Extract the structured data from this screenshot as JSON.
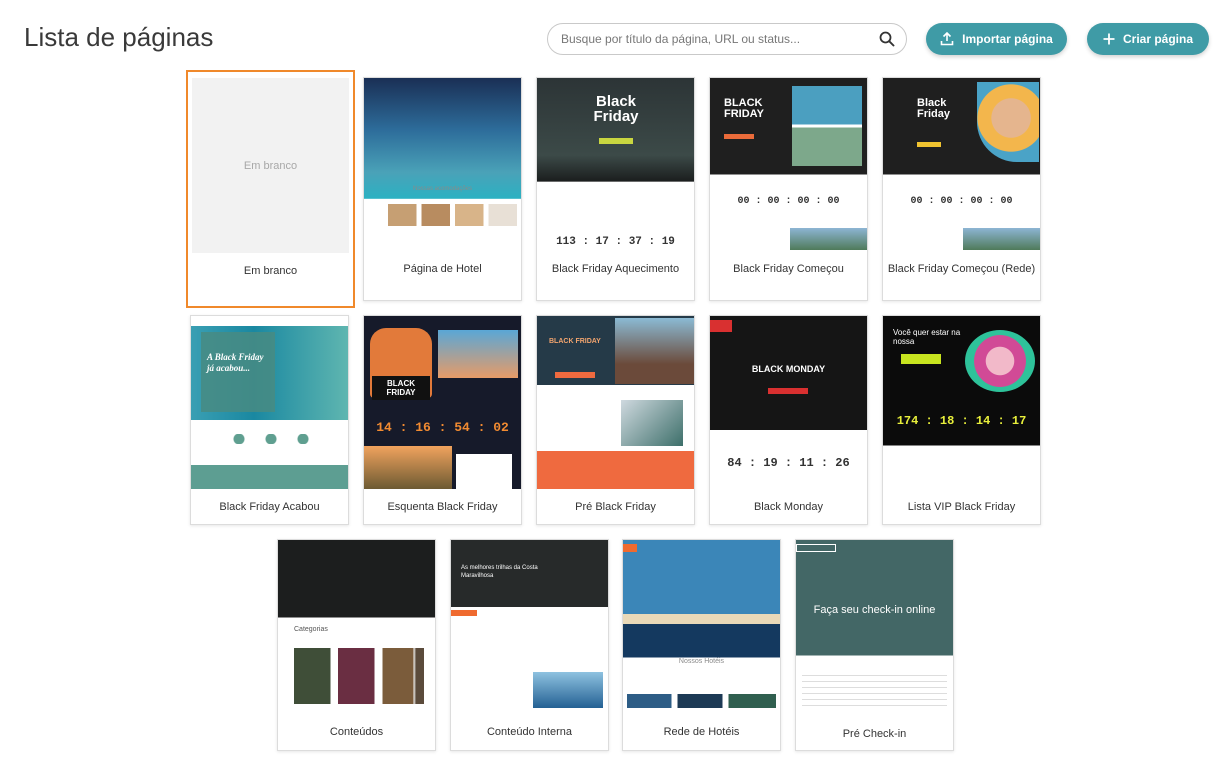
{
  "header": {
    "title": "Lista de páginas",
    "search_placeholder": "Busque por título da página, URL ou status...",
    "import_label": "Importar página",
    "create_label": "Criar página"
  },
  "colors": {
    "accent": "#3f9ba6",
    "selected_border": "#f0892b"
  },
  "templates": [
    {
      "label": "Em branco",
      "thumb_text": "Em branco"
    },
    {
      "label": "Página de Hotel",
      "thumb_text": "Nossas acomodações"
    },
    {
      "label": "Black Friday Aquecimento",
      "thumb_text": "Black Friday",
      "countdown": "113 : 17 : 37 : 19"
    },
    {
      "label": "Black Friday Começou",
      "thumb_text": "BLACK FRIDAY",
      "countdown": "00 : 00 : 00 : 00"
    },
    {
      "label": "Black Friday Começou (Rede)",
      "thumb_text": "Black Friday",
      "countdown": "00 : 00 : 00 : 00"
    },
    {
      "label": "Black Friday Acabou",
      "thumb_text": "A Black Friday já acabou..."
    },
    {
      "label": "Esquenta Black Friday",
      "thumb_text": "BLACK FRIDAY",
      "countdown": "14 : 16 : 54 : 02"
    },
    {
      "label": "Pré Black Friday",
      "thumb_text": "BLACK FRIDAY"
    },
    {
      "label": "Black Monday",
      "thumb_text": "BLACK MONDAY",
      "countdown": "84 : 19 : 11 : 26"
    },
    {
      "label": "Lista VIP Black Friday",
      "thumb_text": "Você quer estar na nossa",
      "countdown": "174 : 18 : 14 : 17"
    },
    {
      "label": "Conteúdos",
      "thumb_text": "Categorias"
    },
    {
      "label": "Conteúdo Interna",
      "thumb_text": "As melhores trilhas da Costa Maravilhosa"
    },
    {
      "label": "Rede de Hotéis",
      "thumb_text": "Nossos Hotéis"
    },
    {
      "label": "Pré Check-in",
      "thumb_text": "Faça seu check-in online"
    }
  ]
}
